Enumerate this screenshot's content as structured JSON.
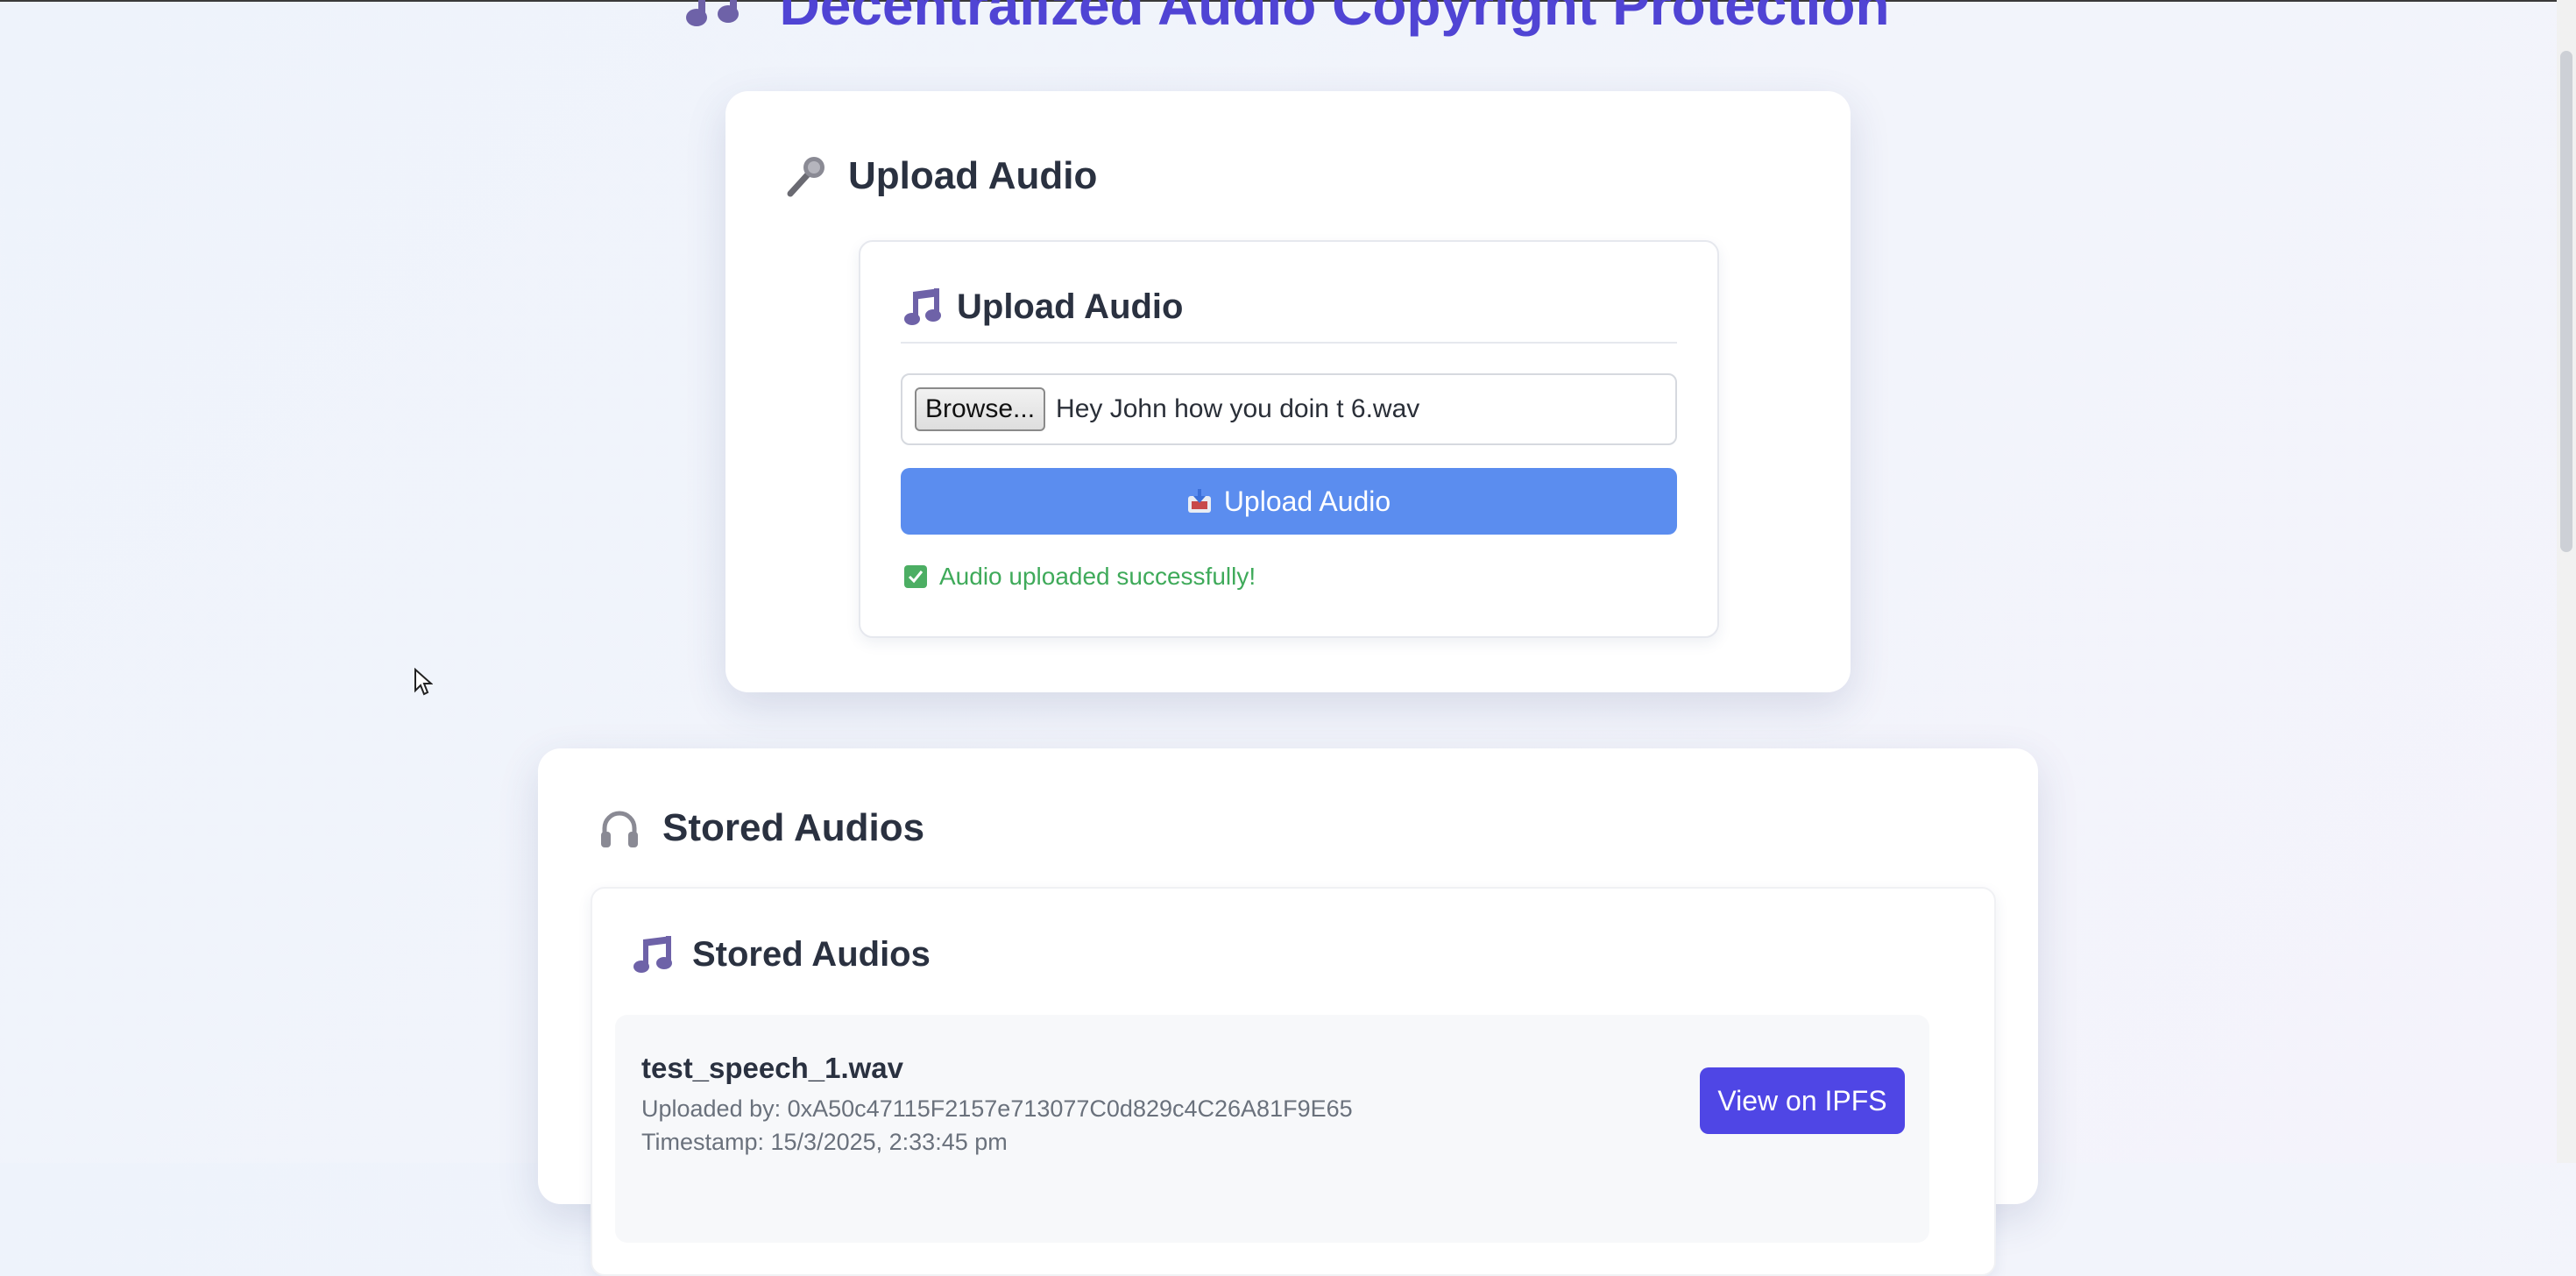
{
  "app": {
    "title": "Decentralized Audio Copyright Protection",
    "title_icon": "music-notes-icon",
    "accent_color": "#5044d4"
  },
  "upload_section": {
    "title": "Upload Audio",
    "icon": "microphone-icon",
    "inner": {
      "title": "Upload Audio",
      "icon": "music-note-icon",
      "browse_label": "Browse...",
      "file_name": "Hey John how you doin t 6.wav",
      "upload_button_label": "Upload Audio",
      "upload_button_icon": "inbox-tray-icon",
      "button_color": "#5b8def",
      "status_message": "Audio uploaded successfully!",
      "status_icon": "check-mark-icon",
      "status_color": "#3faa5a"
    }
  },
  "stored_section": {
    "title": "Stored Audios",
    "icon": "headphones-icon",
    "inner": {
      "title": "Stored Audios",
      "icon": "music-notes-icon",
      "items": [
        {
          "name": "test_speech_1.wav",
          "uploaded_by": "Uploaded by: 0xA50c47115F2157e713077C0d829c4C26A81F9E65",
          "timestamp": "Timestamp: 15/3/2025, 2:33:45 pm",
          "button_label": "View on IPFS",
          "button_color": "#4f46e5"
        }
      ]
    }
  }
}
